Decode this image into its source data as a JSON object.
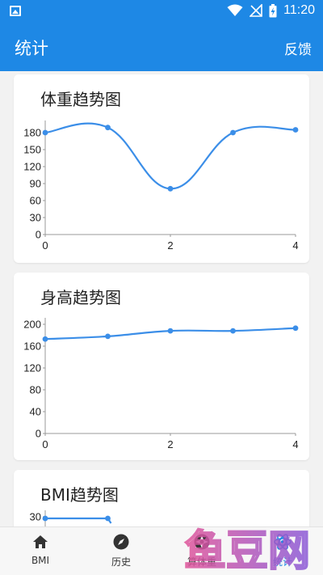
{
  "status_bar": {
    "time": "11:20",
    "icons": [
      "image-icon",
      "wifi-icon",
      "no-signal-icon",
      "battery-charging-icon"
    ]
  },
  "app_bar": {
    "title": "统计",
    "action": "反馈"
  },
  "colors": {
    "primary": "#1e88e5",
    "line": "#3b8ee8",
    "axis": "#999999"
  },
  "charts": [
    {
      "title": "体重趋势图",
      "chart_data": {
        "type": "line",
        "x": [
          0,
          1,
          2,
          3,
          4
        ],
        "y": [
          180,
          189,
          81,
          180,
          185
        ],
        "ylim": [
          0,
          190
        ],
        "yticks": [
          0,
          30,
          60,
          90,
          120,
          150,
          180
        ],
        "xticks": [
          0,
          2,
          4
        ]
      }
    },
    {
      "title": "身高趋势图",
      "chart_data": {
        "type": "line",
        "x": [
          0,
          1,
          2,
          3,
          4
        ],
        "y": [
          173,
          178,
          188,
          188,
          193
        ],
        "ylim": [
          0,
          200
        ],
        "yticks": [
          0,
          40,
          80,
          120,
          160,
          200
        ],
        "xticks": [
          0,
          2,
          4
        ]
      }
    },
    {
      "title": "BMI趋势图",
      "chart_data": {
        "type": "line",
        "x": [
          0,
          1
        ],
        "y": [
          30,
          30
        ],
        "yticks": [
          30
        ]
      }
    }
  ],
  "nav": [
    {
      "label": "BMI",
      "icon": "home-icon",
      "active": false
    },
    {
      "label": "历史",
      "icon": "compass-icon",
      "active": false
    },
    {
      "label": "算体重",
      "icon": "aperture-icon",
      "active": false
    },
    {
      "label": "统计",
      "icon": "atom-icon",
      "active": true
    }
  ],
  "watermark": {
    "text": "鱼豆网"
  }
}
